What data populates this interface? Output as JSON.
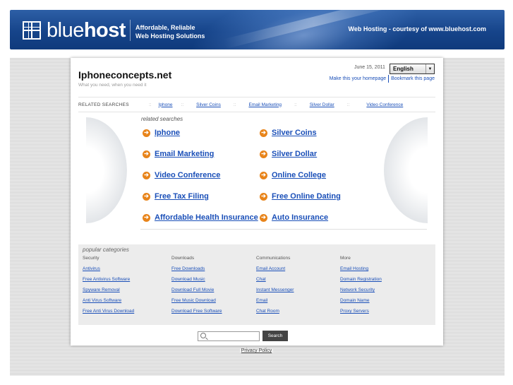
{
  "banner": {
    "logo_light": "blue",
    "logo_bold": "host",
    "tagline_line1": "Affordable, Reliable",
    "tagline_line2": "Web Hosting Solutions",
    "courtesy": "Web Hosting - courtesy of www.bluehost.com"
  },
  "site": {
    "title": "Iphoneconcepts.net",
    "subtitle": "What you need, when you need it",
    "date": "June 15, 2011",
    "language": "English",
    "make_homepage": "Make this your homepage",
    "bookmark": "Bookmark this page"
  },
  "related_bar": {
    "label": "RELATED SEARCHES",
    "separator": "::",
    "items": [
      "Iphone",
      "Silver Coins",
      "Email Marketing",
      "Silver Dollar",
      "Video Conference"
    ]
  },
  "related": {
    "caption": "related searches",
    "bullet": "➔",
    "items": [
      "Iphone",
      "Silver Coins",
      "Email Marketing",
      "Silver Dollar",
      "Video Conference",
      "Online College",
      "Free Tax Filing",
      "Free Online Dating",
      "Affordable Health Insurance",
      "Auto Insurance"
    ]
  },
  "popular": {
    "title": "popular categories",
    "columns": [
      {
        "head": "Security",
        "links": [
          "Antivirus",
          "Free Antivirus Software",
          "Spyware Removal",
          "Anti Virus Software",
          "Free Anti Virus Download"
        ]
      },
      {
        "head": "Downloads",
        "links": [
          "Free Downloads",
          "Download Music",
          "Download Full Movie",
          "Free Music Download",
          "Download Free Software"
        ]
      },
      {
        "head": "Communications",
        "links": [
          "Email Account",
          "Chat",
          "Instant Messenger",
          "Email",
          "Chat Room"
        ]
      },
      {
        "head": "More",
        "links": [
          "Email Hosting",
          "Domain Registration",
          "Network Security",
          "Domain Name",
          "Proxy Servers"
        ]
      }
    ]
  },
  "search": {
    "button": "Search",
    "value": ""
  },
  "footer": {
    "privacy": "Privacy Policy"
  },
  "colors": {
    "link": "#1a4fb8",
    "bullet": "#e8841a",
    "banner": "#16448a"
  }
}
